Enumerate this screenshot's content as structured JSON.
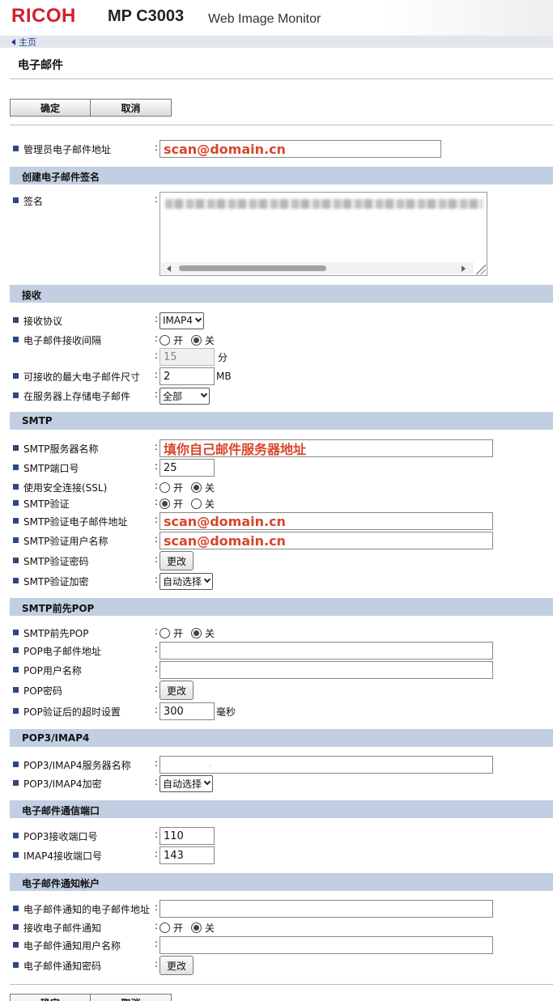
{
  "header": {
    "logo": "RICOH",
    "model": "MP C3003",
    "product": "Web Image Monitor"
  },
  "nav": {
    "home": "主页"
  },
  "page": {
    "title": "电子邮件"
  },
  "buttons": {
    "ok": "确定",
    "cancel": "取消",
    "change": "更改"
  },
  "options": {
    "on": "开",
    "off": "关"
  },
  "admin": {
    "label": "管理员电子邮件地址",
    "value": "scan@domain.cn"
  },
  "signature": {
    "section": "创建电子邮件签名",
    "label": "签名"
  },
  "receive": {
    "section": "接收",
    "protocol_label": "接收协议",
    "protocol_value": "IMAP4",
    "interval_label": "电子邮件接收间隔",
    "interval_value": "15",
    "interval_unit": "分",
    "max_size_label": "可接收的最大电子邮件尺寸",
    "max_size_value": "2",
    "max_size_unit": "MB",
    "store_label": "在服务器上存储电子邮件",
    "store_value": "全部"
  },
  "smtp": {
    "section": "SMTP",
    "server_label": "SMTP服务器名称",
    "server_value": "填你自己邮件服务器地址",
    "port_label": "SMTP端口号",
    "port_value": "25",
    "ssl_label": "使用安全连接(SSL)",
    "auth_label": "SMTP验证",
    "auth_email_label": "SMTP验证电子邮件地址",
    "auth_email_value": "scan@domain.cn",
    "auth_user_label": "SMTP验证用户名称",
    "auth_user_value": "scan@domain.cn",
    "auth_pass_label": "SMTP验证密码",
    "auth_enc_label": "SMTP验证加密",
    "auth_enc_value": "自动选择"
  },
  "pop_before": {
    "section": "SMTP前先POP",
    "toggle_label": "SMTP前先POP",
    "email_label": "POP电子邮件地址",
    "user_label": "POP用户名称",
    "pass_label": "POP密码",
    "timeout_label": "POP验证后的超时设置",
    "timeout_value": "300",
    "timeout_unit": "毫秒"
  },
  "popimap": {
    "section": "POP3/IMAP4",
    "server_label": "POP3/IMAP4服务器名称",
    "server_value": ".",
    "enc_label": "POP3/IMAP4加密",
    "enc_value": "自动选择"
  },
  "ports": {
    "section": "电子邮件通信端口",
    "pop3_label": "POP3接收端口号",
    "pop3_value": "110",
    "imap4_label": "IMAP4接收端口号",
    "imap4_value": "143"
  },
  "notify": {
    "section": "电子邮件通知帐户",
    "email_label": "电子邮件通知的电子邮件地址",
    "receive_label": "接收电子邮件通知",
    "user_label": "电子邮件通知用户名称",
    "pass_label": "电子邮件通知密码"
  },
  "state": {
    "interval": "off",
    "ssl": "off",
    "smtp_auth": "on",
    "pop_before": "off",
    "notify_receive": "off"
  }
}
